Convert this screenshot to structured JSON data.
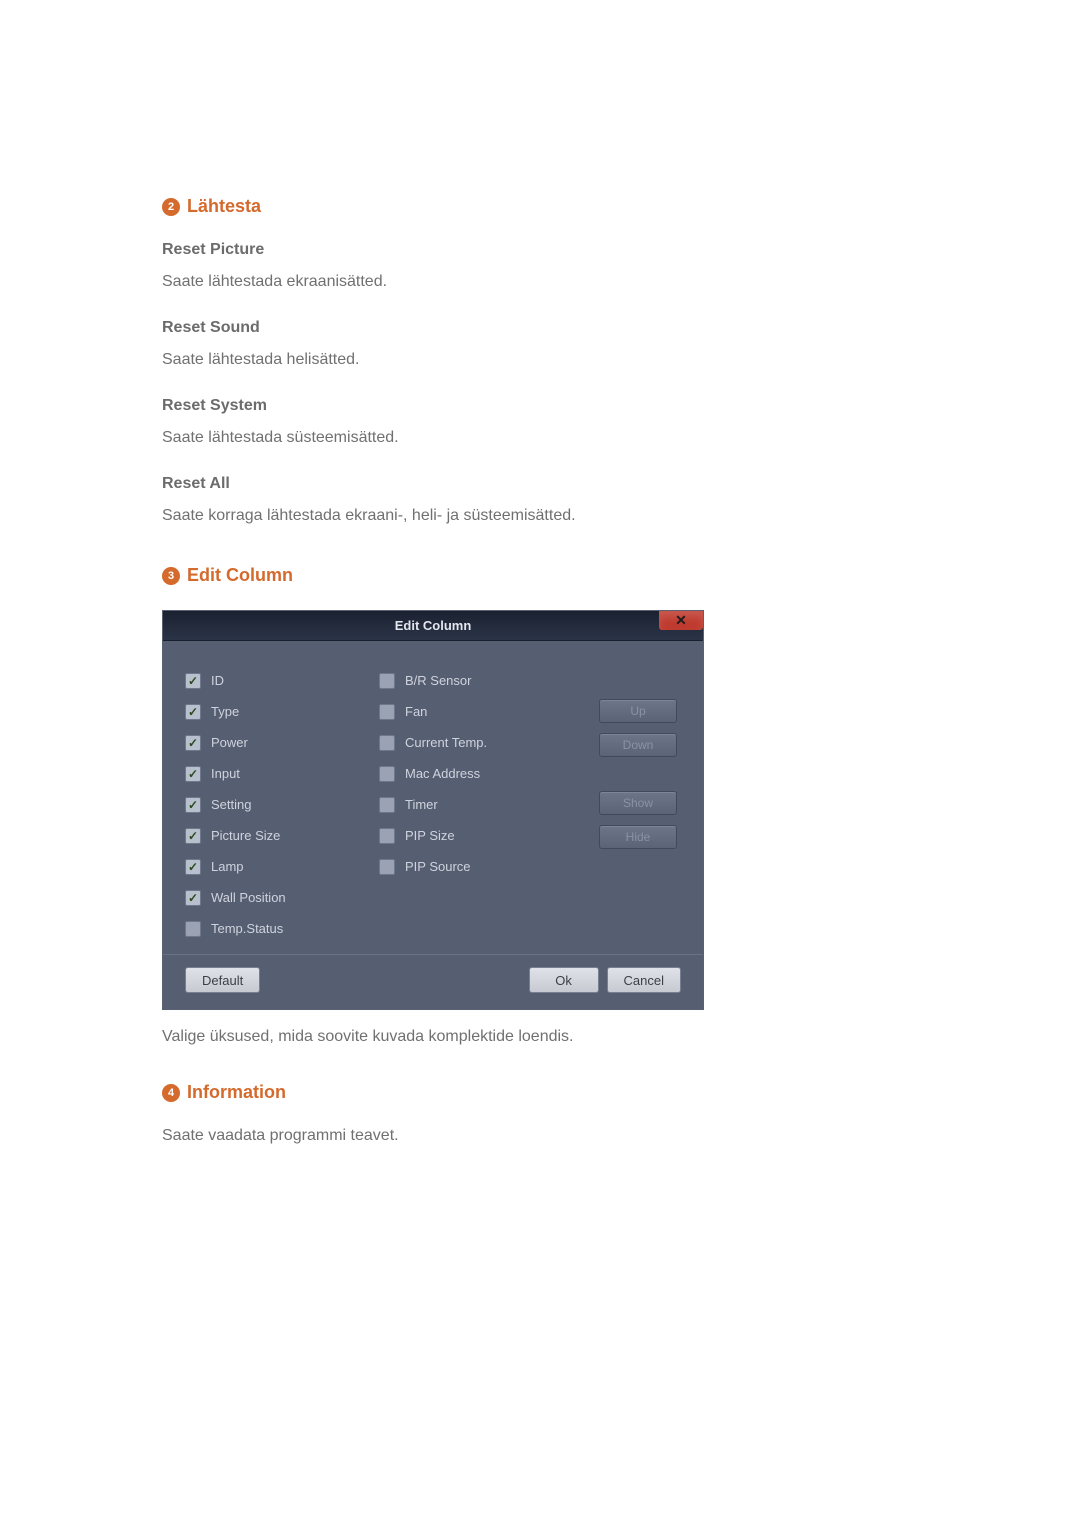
{
  "section2": {
    "num": "2",
    "title": "Lähtesta",
    "items": [
      {
        "heading": "Reset Picture",
        "body": "Saate lähtestada ekraanisätted."
      },
      {
        "heading": "Reset Sound",
        "body": "Saate lähtestada helisätted."
      },
      {
        "heading": "Reset System",
        "body": "Saate lähtestada süsteemisätted."
      },
      {
        "heading": "Reset All",
        "body": "Saate korraga lähtestada ekraani-, heli- ja süsteemisätted."
      }
    ]
  },
  "section3": {
    "num": "3",
    "title": "Edit Column",
    "dialog": {
      "title": "Edit Column",
      "left_column": [
        {
          "label": "ID",
          "checked": true
        },
        {
          "label": "Type",
          "checked": true
        },
        {
          "label": "Power",
          "checked": true
        },
        {
          "label": "Input",
          "checked": true
        },
        {
          "label": "Setting",
          "checked": true
        },
        {
          "label": "Picture Size",
          "checked": true
        },
        {
          "label": "Lamp",
          "checked": true
        },
        {
          "label": "Wall Position",
          "checked": true
        },
        {
          "label": "Temp.Status",
          "checked": false
        }
      ],
      "right_column": [
        {
          "label": "B/R Sensor",
          "checked": false
        },
        {
          "label": "Fan",
          "checked": false
        },
        {
          "label": "Current Temp.",
          "checked": false
        },
        {
          "label": "Mac Address",
          "checked": false
        },
        {
          "label": "Timer",
          "checked": false
        },
        {
          "label": "PIP Size",
          "checked": false
        },
        {
          "label": "PIP Source",
          "checked": false
        }
      ],
      "side_buttons": [
        "Up",
        "Down",
        "Show",
        "Hide"
      ],
      "footer_buttons": {
        "default": "Default",
        "ok": "Ok",
        "cancel": "Cancel"
      }
    },
    "body": "Valige üksused, mida soovite kuvada komplektide loendis."
  },
  "section4": {
    "num": "4",
    "title": "Information",
    "body": "Saate vaadata programmi teavet."
  }
}
